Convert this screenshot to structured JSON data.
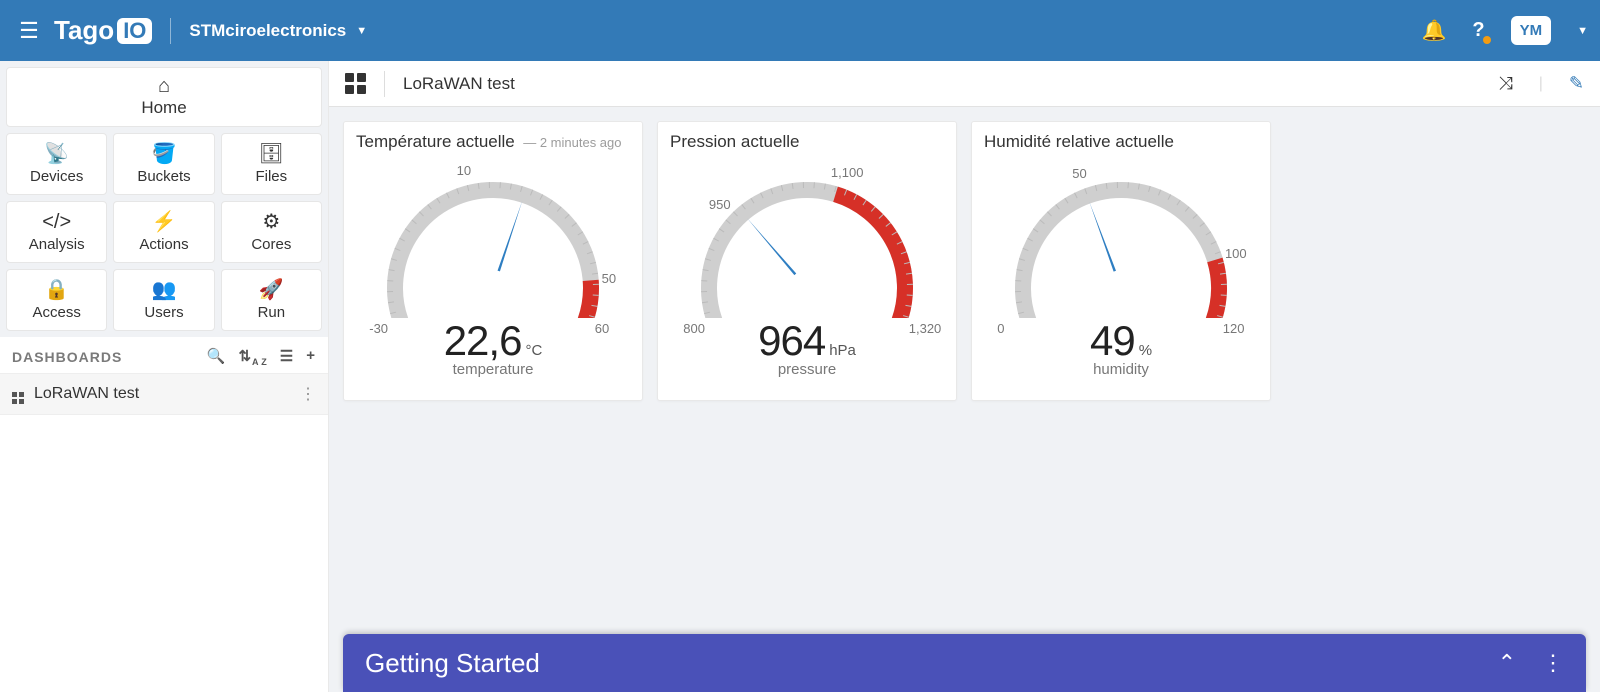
{
  "header": {
    "logo_text": "Tago",
    "logo_badge": "IO",
    "workspace": "STMciroelectronics",
    "avatar": "YM"
  },
  "sidebar": {
    "home": "Home",
    "tiles": [
      {
        "icon": "remote",
        "label": "Devices"
      },
      {
        "icon": "bucket",
        "label": "Buckets"
      },
      {
        "icon": "files",
        "label": "Files"
      },
      {
        "icon": "code",
        "label": "Analysis"
      },
      {
        "icon": "bolt",
        "label": "Actions"
      },
      {
        "icon": "core",
        "label": "Cores"
      },
      {
        "icon": "lock",
        "label": "Access"
      },
      {
        "icon": "users",
        "label": "Users"
      },
      {
        "icon": "rocket",
        "label": "Run"
      }
    ],
    "dash_header": "DASHBOARDS",
    "dash_item": "LoRaWAN test"
  },
  "toolbar": {
    "title": "LoRaWAN test"
  },
  "cards": [
    {
      "title": "Température actuelle",
      "sub": "— 2 minutes ago",
      "value": "22,6",
      "unit": "°C",
      "var": "temperature",
      "min": -30,
      "max": 60,
      "red_from": 50,
      "needle": 22.6,
      "ticks": [
        {
          "v": -30,
          "t": "-30"
        },
        {
          "v": 10,
          "t": "10"
        },
        {
          "v": 50,
          "t": "50"
        },
        {
          "v": 60,
          "t": "60"
        }
      ]
    },
    {
      "title": "Pression actuelle",
      "sub": "",
      "value": "964",
      "unit": "hPa",
      "var": "pressure",
      "min": 800,
      "max": 1320,
      "red_from": 1100,
      "needle": 964,
      "ticks": [
        {
          "v": 800,
          "t": "800"
        },
        {
          "v": 950,
          "t": "950"
        },
        {
          "v": 1100,
          "t": "1,100"
        },
        {
          "v": 1320,
          "t": "1,320"
        }
      ]
    },
    {
      "title": "Humidité relative actuelle",
      "sub": "",
      "value": "49",
      "unit": "%",
      "var": "humidity",
      "min": 0,
      "max": 120,
      "red_from": 100,
      "needle": 49,
      "ticks": [
        {
          "v": 0,
          "t": "0"
        },
        {
          "v": 50,
          "t": "50"
        },
        {
          "v": 100,
          "t": "100"
        },
        {
          "v": 120,
          "t": "120"
        }
      ]
    }
  ],
  "bottom": {
    "title": "Getting Started"
  },
  "chart_data": [
    {
      "type": "gauge",
      "title": "Température actuelle",
      "value": 22.6,
      "unit": "°C",
      "variable": "temperature",
      "range": [
        -30,
        60
      ],
      "danger_from": 50,
      "ticks": [
        -30,
        10,
        50,
        60
      ],
      "updated": "2 minutes ago"
    },
    {
      "type": "gauge",
      "title": "Pression actuelle",
      "value": 964,
      "unit": "hPa",
      "variable": "pressure",
      "range": [
        800,
        1320
      ],
      "danger_from": 1100,
      "ticks": [
        800,
        950,
        1100,
        1320
      ]
    },
    {
      "type": "gauge",
      "title": "Humidité relative actuelle",
      "value": 49,
      "unit": "%",
      "variable": "humidity",
      "range": [
        0,
        120
      ],
      "danger_from": 100,
      "ticks": [
        0,
        50,
        100,
        120
      ]
    }
  ]
}
